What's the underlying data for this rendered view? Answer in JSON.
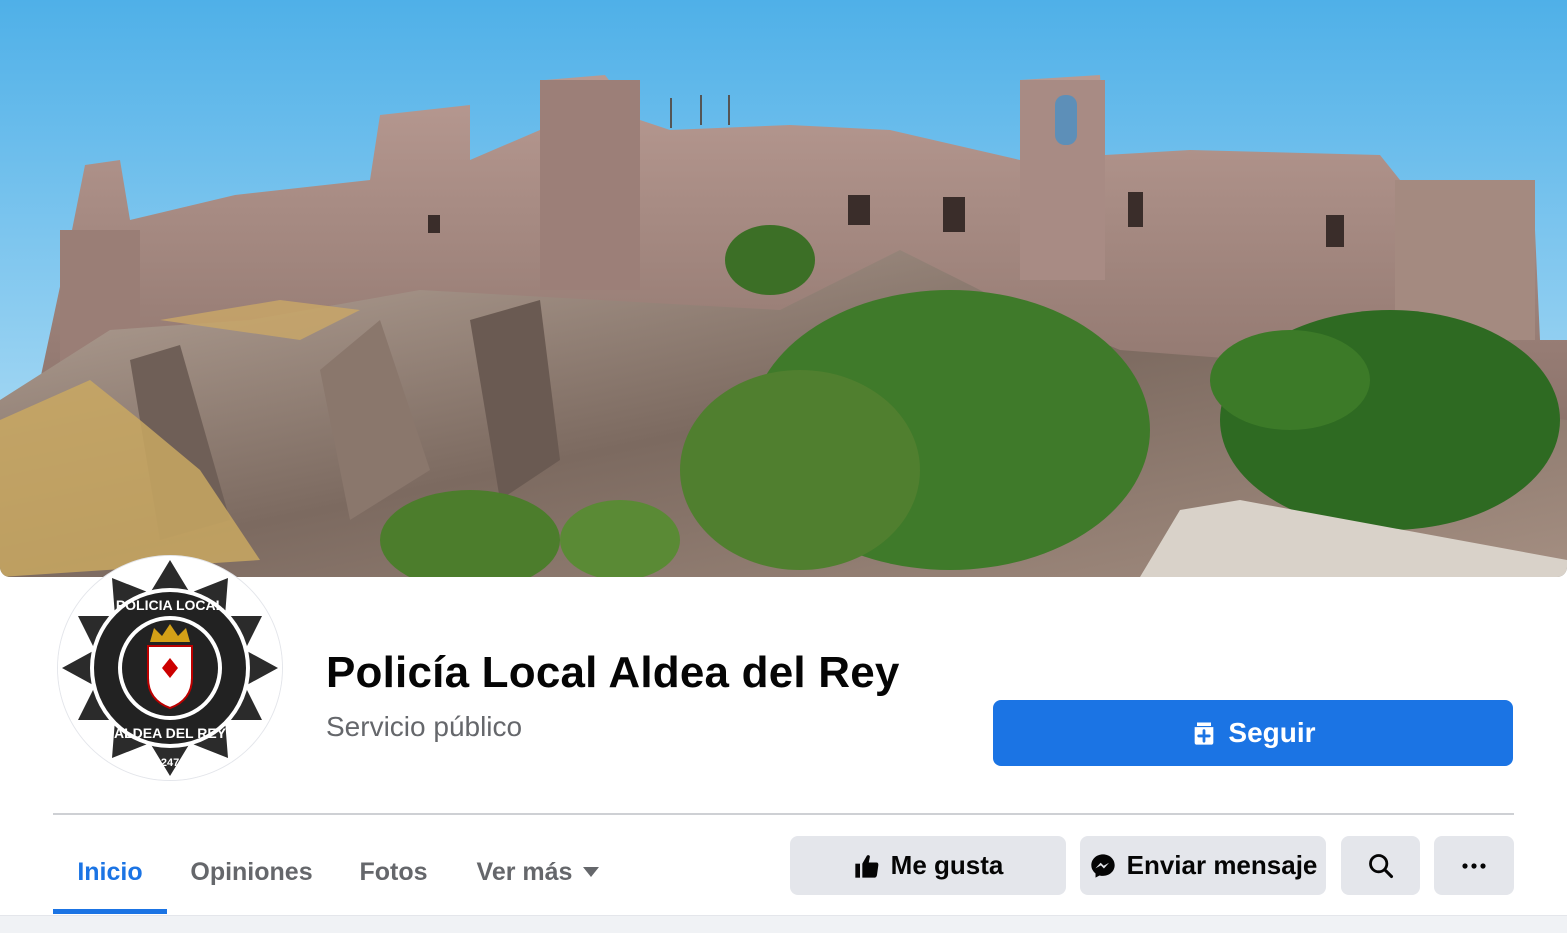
{
  "cover": {
    "description_icon": "cover-photo-castle"
  },
  "profile": {
    "name": "Policía Local Aldea del Rey",
    "category": "Servicio público",
    "badge_top": "POLICIA LOCAL",
    "badge_bottom": "ALDEA DEL REY",
    "badge_number": "247"
  },
  "actions": {
    "follow_label": "Seguir",
    "like_label": "Me gusta",
    "message_label": "Enviar mensaje",
    "search_icon": "search-icon",
    "more_icon": "more-icon"
  },
  "tabs": [
    {
      "label": "Inicio",
      "active": true
    },
    {
      "label": "Opiniones",
      "active": false
    },
    {
      "label": "Fotos",
      "active": false
    },
    {
      "label": "Ver más",
      "active": false
    }
  ],
  "colors": {
    "accent": "#1b74e4",
    "button_gray": "#e4e6eb",
    "secondary_text": "#65676b"
  }
}
